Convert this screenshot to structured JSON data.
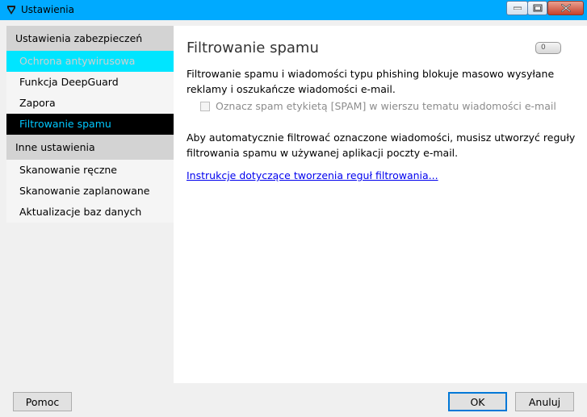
{
  "window": {
    "title": "Ustawienia",
    "icon": "shield-icon",
    "controls": [
      "minimize-icon",
      "maximize-icon",
      "close-icon"
    ]
  },
  "sidebar": {
    "sections": [
      {
        "header": "Ustawienia zabezpieczeń",
        "items": [
          {
            "label": "Ochrona antywirusowa",
            "state": "highlighted"
          },
          {
            "label": "Funkcja DeepGuard",
            "state": "normal"
          },
          {
            "label": "Zapora",
            "state": "normal"
          },
          {
            "label": "Filtrowanie spamu",
            "state": "selected"
          }
        ]
      },
      {
        "header": "Inne ustawienia",
        "items": [
          {
            "label": "Skanowanie ręczne",
            "state": "normal"
          },
          {
            "label": "Skanowanie zaplanowane",
            "state": "normal"
          },
          {
            "label": "Aktualizacje baz danych",
            "state": "normal"
          }
        ]
      }
    ]
  },
  "panel": {
    "title": "Filtrowanie spamu",
    "toggle_label": "0",
    "description": "Filtrowanie spamu i wiadomości typu phishing blokuje masowo wysyłane reklamy i oszukańcze wiadomości e-mail.",
    "checkbox_label": "Oznacz spam etykietą [SPAM] w wierszu tematu wiadomości e-mail",
    "checkbox_checked": false,
    "info": "Aby automatycznie filtrować oznaczone wiadomości, musisz utworzyć reguły filtrowania spamu w używanej aplikacji poczty e-mail.",
    "link": "Instrukcje dotyczące tworzenia reguł filtrowania..."
  },
  "footer": {
    "help_label": "Pomoc",
    "ok_label": "OK",
    "cancel_label": "Anuluj"
  },
  "colors": {
    "titlebar": "#00aaff",
    "highlight_item": "#00e5ff",
    "selected_item_bg": "#000000",
    "selected_item_text": "#00c8ff",
    "link": "#0000ee"
  }
}
